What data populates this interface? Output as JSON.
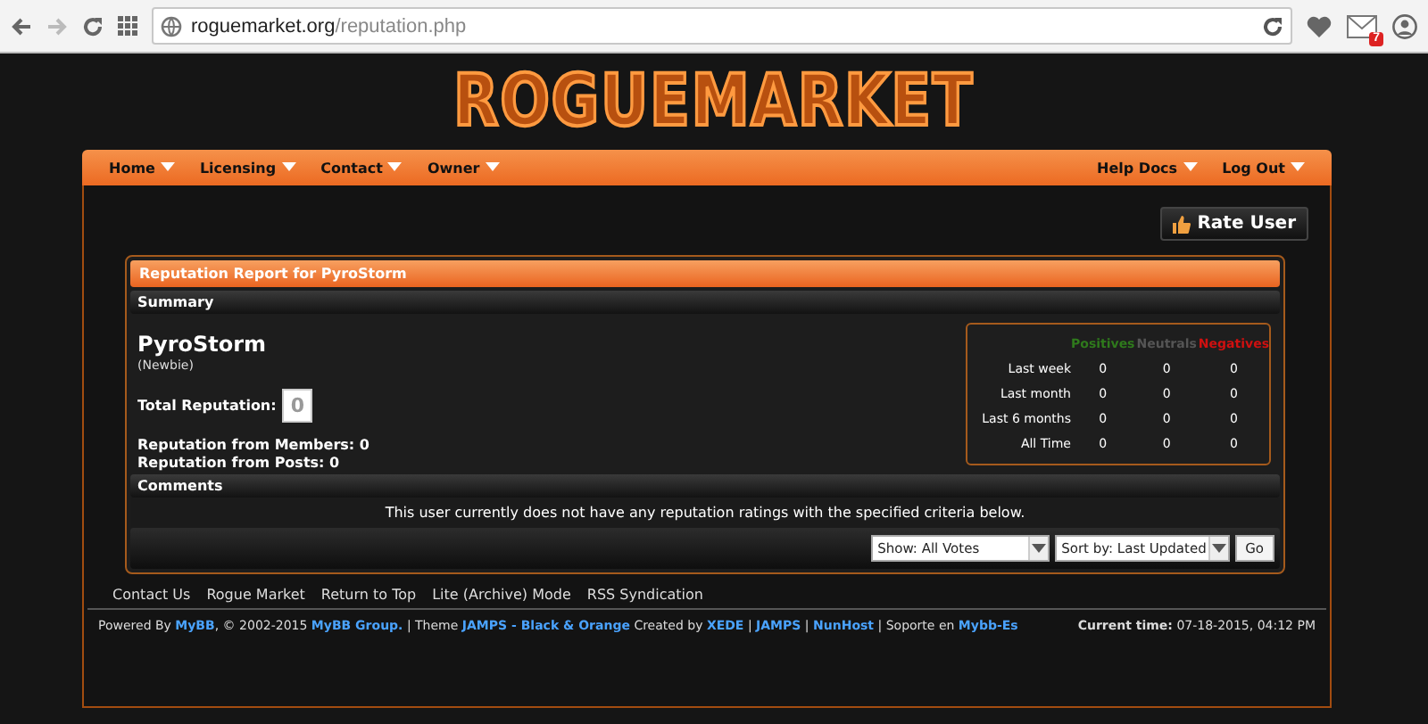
{
  "browser": {
    "url_host": "roguemarket.org",
    "url_path": "/reputation.php",
    "mail_badge": "7"
  },
  "logo": "ROGUEMARKET",
  "nav": {
    "left": [
      {
        "label": "Home"
      },
      {
        "label": "Licensing"
      },
      {
        "label": "Contact"
      },
      {
        "label": "Owner"
      }
    ],
    "right": [
      {
        "label": "Help Docs"
      },
      {
        "label": "Log Out"
      }
    ]
  },
  "rate_button": "Rate User",
  "report": {
    "title": "Reputation Report for PyroStorm",
    "summary_heading": "Summary",
    "username": "PyroStorm",
    "rank": "(Newbie)",
    "total_label": "Total Reputation:",
    "total_value": "0",
    "members_line": "Reputation from Members: 0",
    "posts_line": "Reputation from Posts: 0",
    "stats": {
      "columns": [
        {
          "label": "Positives",
          "color": "#2f7a1c"
        },
        {
          "label": "Neutrals",
          "color": "#555555"
        },
        {
          "label": "Negatives",
          "color": "#d01010"
        }
      ],
      "rows": [
        {
          "label": "Last week",
          "values": [
            "0",
            "0",
            "0"
          ]
        },
        {
          "label": "Last month",
          "values": [
            "0",
            "0",
            "0"
          ]
        },
        {
          "label": "Last 6 months",
          "values": [
            "0",
            "0",
            "0"
          ]
        },
        {
          "label": "All Time",
          "values": [
            "0",
            "0",
            "0"
          ]
        }
      ]
    }
  },
  "comments": {
    "heading": "Comments",
    "message": "This user currently does not have any reputation ratings with the specified criteria below.",
    "show_select": "Show: All Votes",
    "sort_select": "Sort by: Last Updated",
    "go_button": "Go"
  },
  "footer_links": [
    "Contact Us",
    "Rogue Market",
    "Return to Top",
    "Lite (Archive) Mode",
    "RSS Syndication"
  ],
  "credits": [
    {
      "kind": "text",
      "text": "Powered By "
    },
    {
      "kind": "link",
      "text": "MyBB"
    },
    {
      "kind": "text",
      "text": ", © 2002-2015 "
    },
    {
      "kind": "link",
      "text": "MyBB Group."
    },
    {
      "kind": "text",
      "text": " | Theme "
    },
    {
      "kind": "link",
      "text": "JAMPS - Black & Orange"
    },
    {
      "kind": "text",
      "text": " Created by "
    },
    {
      "kind": "link",
      "text": "XEDE"
    },
    {
      "kind": "text",
      "text": " | "
    },
    {
      "kind": "link",
      "text": "JAMPS"
    },
    {
      "kind": "text",
      "text": " | "
    },
    {
      "kind": "link",
      "text": "NunHost"
    },
    {
      "kind": "text",
      "text": " | Soporte en "
    },
    {
      "kind": "link",
      "text": "Mybb-Es"
    }
  ],
  "current_time": "**Current time:** 07-18-2015, 04:12 PM"
}
